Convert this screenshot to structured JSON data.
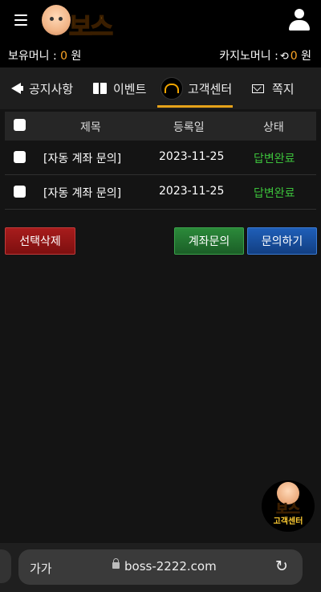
{
  "header": {
    "logo_text": "보스"
  },
  "balance": {
    "left_label": "보유머니 :",
    "left_amount": "0",
    "left_unit": "원",
    "right_label": "카지노머니 :",
    "right_amount": "0",
    "right_unit": "원"
  },
  "tabs": [
    {
      "label": "공지사항",
      "icon": "megaphone-icon"
    },
    {
      "label": "이벤트",
      "icon": "gift-icon"
    },
    {
      "label": "고객센터",
      "icon": "headset-icon",
      "active": true
    },
    {
      "label": "쪽지",
      "icon": "envelope-icon"
    }
  ],
  "table": {
    "columns": [
      "제목",
      "등록일",
      "상태"
    ],
    "rows": [
      {
        "title": "[자동 계좌 문의]",
        "date": "2023-11-25",
        "status": "답변완료"
      },
      {
        "title": "[자동 계좌 문의]",
        "date": "2023-11-25",
        "status": "답변완료"
      }
    ]
  },
  "buttons": {
    "delete": "선택삭제",
    "account_inquiry": "계좌문의",
    "inquire": "문의하기"
  },
  "badge": {
    "title": "보스",
    "subtitle": "고객센터"
  },
  "browser": {
    "text_size": "가가",
    "url": "boss-2222.com"
  },
  "colors": {
    "accent": "#e6a21a",
    "status_done": "#3cc13b",
    "delete_btn": "#a81c1c",
    "account_btn": "#2b8a3a",
    "inquire_btn": "#1f5fb8"
  }
}
